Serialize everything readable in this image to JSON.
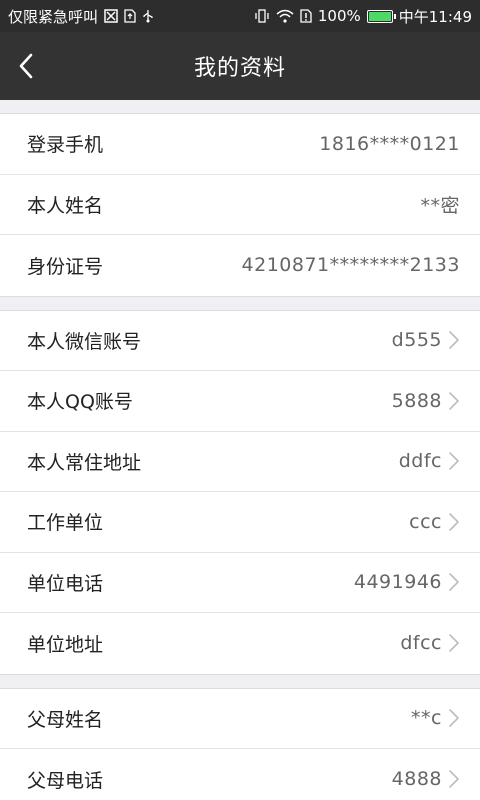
{
  "status_bar": {
    "carrier": "仅限紧急呼叫",
    "battery_percent": "100%",
    "time": "中午11:49",
    "battery_level": 1.0,
    "battery_color": "#4cd964"
  },
  "nav": {
    "title": "我的资料",
    "back_icon": "chevron-left-icon"
  },
  "groups": [
    {
      "rows": [
        {
          "label": "登录手机",
          "value": "1816****0121",
          "arrow": false
        },
        {
          "label": "本人姓名",
          "value": "**密",
          "arrow": false
        },
        {
          "label": "身份证号",
          "value": "4210871********2133",
          "arrow": false
        }
      ]
    },
    {
      "rows": [
        {
          "label": "本人微信账号",
          "value": "d555",
          "arrow": true
        },
        {
          "label": "本人QQ账号",
          "value": "5888",
          "arrow": true
        },
        {
          "label": "本人常住地址",
          "value": "ddfc",
          "arrow": true
        },
        {
          "label": "工作单位",
          "value": "ccc",
          "arrow": true
        },
        {
          "label": "单位电话",
          "value": "4491946",
          "arrow": true
        },
        {
          "label": "单位地址",
          "value": "dfcc",
          "arrow": true
        }
      ]
    },
    {
      "rows": [
        {
          "label": "父母姓名",
          "value": "**c",
          "arrow": true
        },
        {
          "label": "父母电话",
          "value": "4888",
          "arrow": true
        }
      ]
    }
  ]
}
